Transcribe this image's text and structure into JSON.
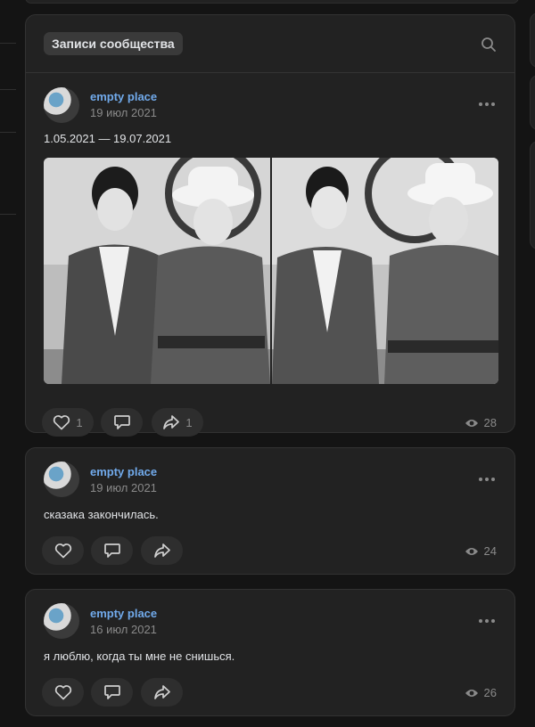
{
  "feed": {
    "title": "Записи сообщества"
  },
  "posts": [
    {
      "author": "empty place",
      "date": "19 июл 2021",
      "text": "1.05.2021 — 19.07.2021",
      "likes": "1",
      "reposts": "1",
      "views": "28",
      "photos": [
        "photo-1",
        "photo-2"
      ]
    },
    {
      "author": "empty place",
      "date": "19 июл 2021",
      "text": "сказака закончилась.",
      "likes": "",
      "reposts": "",
      "views": "24"
    },
    {
      "author": "empty place",
      "date": "16 июл 2021",
      "text": "я люблю, когда ты мне не снишься.",
      "likes": "",
      "reposts": "",
      "views": "26"
    }
  ],
  "colors": {
    "background": "#141414",
    "card": "#222222",
    "author_link": "#71aaeb",
    "muted": "#8a8a8a"
  },
  "icons": [
    "search-icon",
    "more-icon",
    "heart-icon",
    "comment-icon",
    "share-icon",
    "eye-icon"
  ]
}
